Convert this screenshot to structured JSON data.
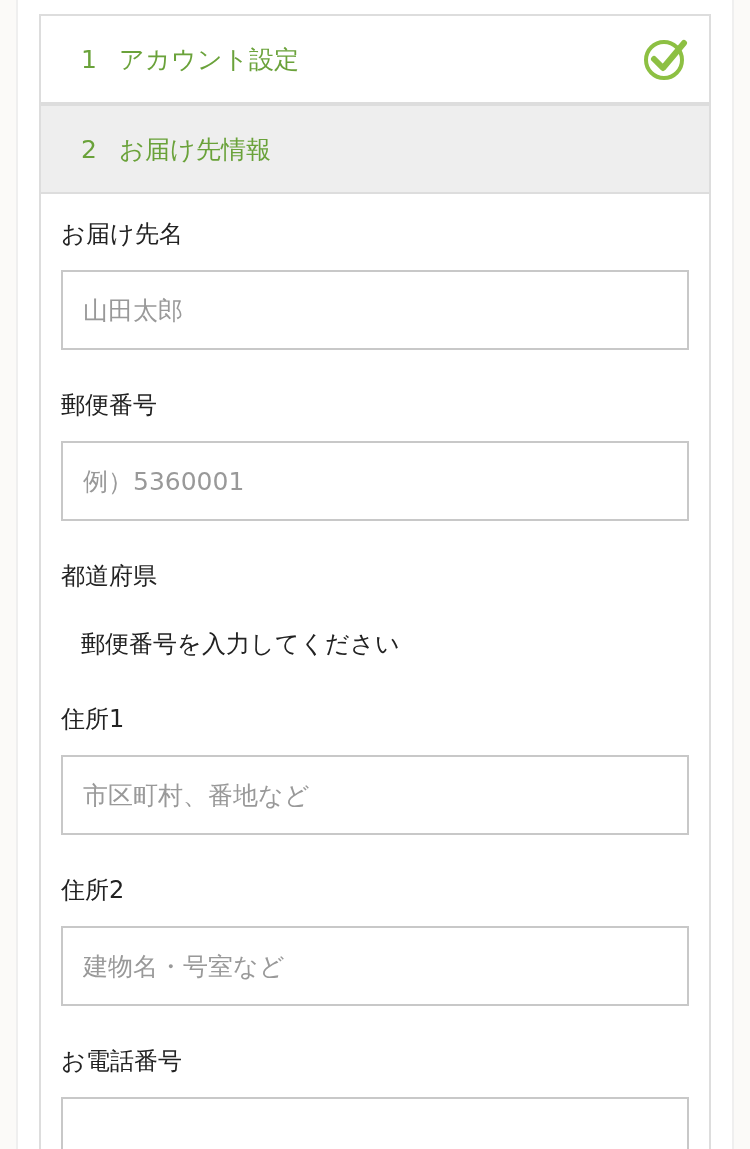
{
  "steps": [
    {
      "number": "1",
      "title": "アカウント設定",
      "completed": true,
      "selected": false
    },
    {
      "number": "2",
      "title": "お届け先情報",
      "completed": false,
      "selected": true
    }
  ],
  "fields": [
    {
      "kind": "input",
      "label": "お届け先名",
      "placeholder": "山田太郎"
    },
    {
      "kind": "input",
      "label": "郵便番号",
      "placeholder": "例）5360001"
    },
    {
      "kind": "text",
      "label": "都道府県",
      "value": "郵便番号を入力してください"
    },
    {
      "kind": "input",
      "label": "住所1",
      "placeholder": "市区町村、番地など"
    },
    {
      "kind": "input",
      "label": "住所2",
      "placeholder": "建物名・号室など"
    },
    {
      "kind": "input",
      "label": "お電話番号"
    }
  ]
}
